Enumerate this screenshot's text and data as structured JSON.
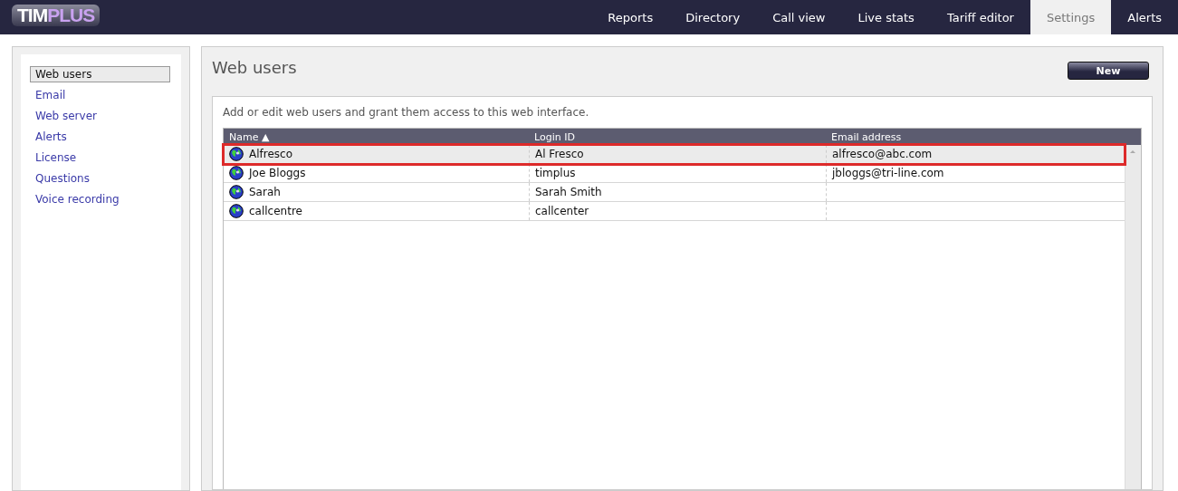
{
  "logo": {
    "part_1": "TIM",
    "part_2": "PLUS"
  },
  "nav": [
    {
      "label": "Reports",
      "selected": false
    },
    {
      "label": "Directory",
      "selected": false
    },
    {
      "label": "Call view",
      "selected": false
    },
    {
      "label": "Live stats",
      "selected": false
    },
    {
      "label": "Tariff editor",
      "selected": false
    },
    {
      "label": "Settings",
      "selected": true
    },
    {
      "label": "Alerts",
      "selected": false
    }
  ],
  "sidebar": {
    "items": [
      {
        "label": "Web users",
        "selected": true
      },
      {
        "label": "Email",
        "selected": false
      },
      {
        "label": "Web server",
        "selected": false
      },
      {
        "label": "Alerts",
        "selected": false
      },
      {
        "label": "License",
        "selected": false
      },
      {
        "label": "Questions",
        "selected": false
      },
      {
        "label": "Voice recording",
        "selected": false
      }
    ]
  },
  "page": {
    "title": "Web users",
    "new_button": "New",
    "description": "Add or edit web users and grant them access to this web interface."
  },
  "table": {
    "columns": [
      {
        "label": "Name ▲"
      },
      {
        "label": "Login ID"
      },
      {
        "label": "Email address"
      }
    ],
    "rows": [
      {
        "name": "Alfresco",
        "login": "Al Fresco",
        "email": "alfresco@abc.com",
        "selected": true
      },
      {
        "name": "Joe Bloggs",
        "login": "timplus",
        "email": "jbloggs@tri-line.com",
        "selected": false
      },
      {
        "name": "Sarah",
        "login": "Sarah Smith",
        "selected": false
      },
      {
        "name": "callcentre",
        "login": "callcenter",
        "selected": false
      }
    ]
  }
}
